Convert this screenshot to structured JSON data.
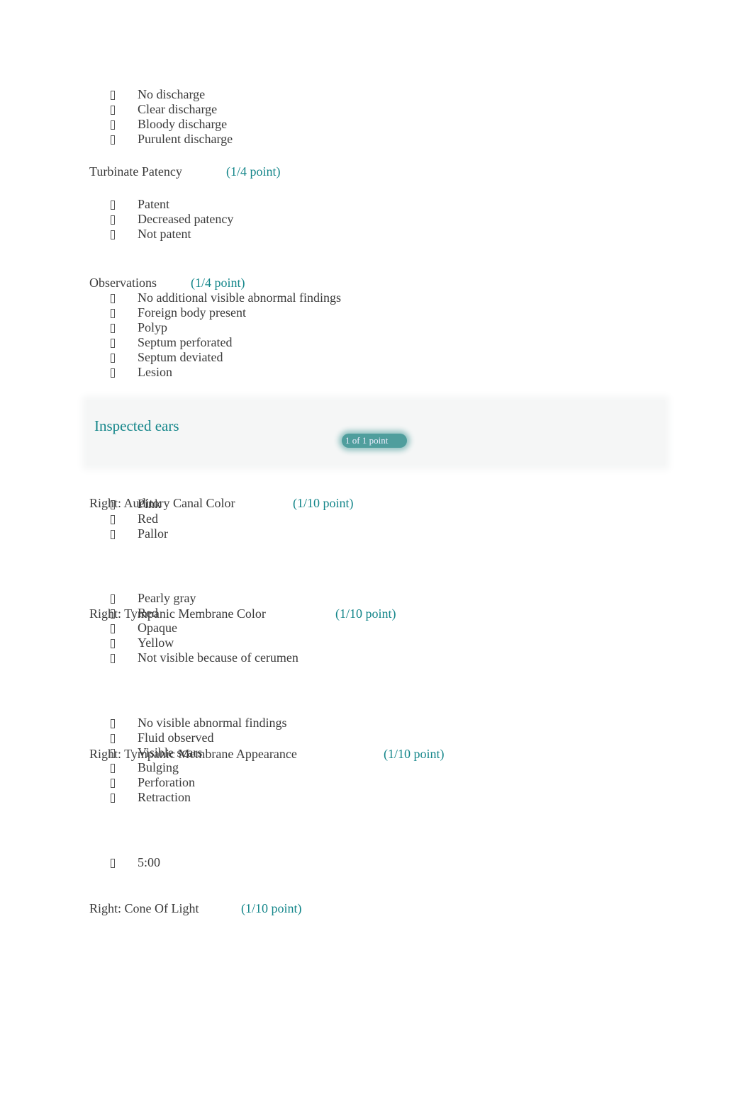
{
  "colors": {
    "accent": "#14868a",
    "text": "#3a3a3a",
    "badge": "#4f9e9d"
  },
  "option_icon": "missing-glyph-box",
  "intro_options": [
    "No discharge",
    "Clear discharge",
    "Bloody discharge",
    "Purulent discharge"
  ],
  "questions": [
    {
      "label": "Turbinate Patency",
      "points": "(1/4 point)",
      "options": [
        "Patent",
        "Decreased patency",
        "Not patent"
      ]
    },
    {
      "label": "Observations",
      "points": "(1/4 point)",
      "options": [
        "No additional visible abnormal findings",
        "Foreign body present",
        "Polyp",
        "Septum perforated",
        "Septum deviated",
        "Lesion"
      ]
    },
    {
      "label": "Right: Auditory Canal Color",
      "points": "(1/10 point)",
      "options": [
        "Pink",
        "Red",
        "Pallor"
      ]
    },
    {
      "label": "Right: Tympanic Membrane Color",
      "points": "(1/10 point)",
      "options": [
        "Pearly gray",
        "Red",
        "Opaque",
        "Yellow",
        "Not visible because of cerumen"
      ]
    },
    {
      "label": "Right: Tympanic Membrane Appearance",
      "points": "(1/10 point)",
      "options": [
        "No visible abnormal findings",
        "Fluid observed",
        "Visible scars",
        "Bulging",
        "Perforation",
        "Retraction"
      ]
    },
    {
      "label": "Right: Cone Of Light",
      "points": "(1/10 point)",
      "options": [
        "5:00"
      ]
    }
  ],
  "section": {
    "title": "Inspected ears",
    "score": "1 of 1 point"
  }
}
